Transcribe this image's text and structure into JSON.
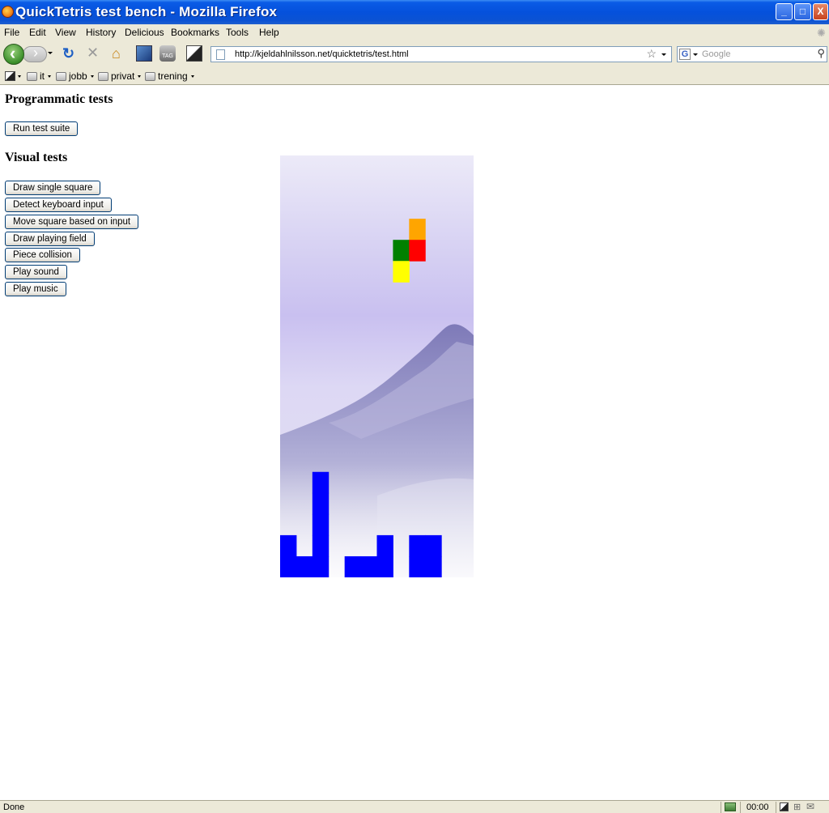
{
  "window": {
    "title": "QuickTetris test bench - Mozilla Firefox",
    "minimize": "_",
    "maximize": "□",
    "close": "X"
  },
  "menu": [
    {
      "label": "File"
    },
    {
      "label": "Edit"
    },
    {
      "label": "View"
    },
    {
      "label": "History"
    },
    {
      "label": "Delicious"
    },
    {
      "label": "Bookmarks"
    },
    {
      "label": "Tools"
    },
    {
      "label": "Help"
    }
  ],
  "navigation": {
    "url": "http://kjeldahlnilsson.net/quicktetris/test.html",
    "search_placeholder": "Google",
    "search_engine_letter": "G"
  },
  "bookmarks": [
    {
      "label": "it"
    },
    {
      "label": "jobb"
    },
    {
      "label": "privat"
    },
    {
      "label": "trening"
    }
  ],
  "page": {
    "programmatic_heading": "Programmatic tests",
    "run_button": "Run test suite",
    "visual_heading": "Visual tests",
    "visual_buttons": [
      {
        "label": "Draw single square"
      },
      {
        "label": "Detect keyboard input"
      },
      {
        "label": "Move square based on input"
      },
      {
        "label": "Draw playing field"
      },
      {
        "label": "Piece collision"
      },
      {
        "label": "Play sound"
      },
      {
        "label": "Play music"
      }
    ]
  },
  "playfield": {
    "columns": 12,
    "rows": 20,
    "falling_piece": [
      {
        "col": 8,
        "row": 3,
        "color": "#ffa500"
      },
      {
        "col": 7,
        "row": 4,
        "color": "#008000"
      },
      {
        "col": 8,
        "row": 4,
        "color": "#ff0000"
      },
      {
        "col": 7,
        "row": 5,
        "color": "#ffff00"
      }
    ],
    "stacked_blocks": [
      {
        "col": 2,
        "row": 15,
        "color": "#0000ff"
      },
      {
        "col": 2,
        "row": 16,
        "color": "#0000ff"
      },
      {
        "col": 2,
        "row": 17,
        "color": "#0000ff"
      },
      {
        "col": 2,
        "row": 18,
        "color": "#0000ff"
      },
      {
        "col": 0,
        "row": 18,
        "color": "#0000ff"
      },
      {
        "col": 0,
        "row": 19,
        "color": "#0000ff"
      },
      {
        "col": 1,
        "row": 19,
        "color": "#0000ff"
      },
      {
        "col": 2,
        "row": 19,
        "color": "#0000ff"
      },
      {
        "col": 6,
        "row": 18,
        "color": "#0000ff"
      },
      {
        "col": 4,
        "row": 19,
        "color": "#0000ff"
      },
      {
        "col": 5,
        "row": 19,
        "color": "#0000ff"
      },
      {
        "col": 6,
        "row": 19,
        "color": "#0000ff"
      },
      {
        "col": 8,
        "row": 18,
        "color": "#0000ff"
      },
      {
        "col": 9,
        "row": 18,
        "color": "#0000ff"
      },
      {
        "col": 8,
        "row": 19,
        "color": "#0000ff"
      },
      {
        "col": 9,
        "row": 19,
        "color": "#0000ff"
      }
    ]
  },
  "status": {
    "text": "Done",
    "time": "00:00"
  }
}
